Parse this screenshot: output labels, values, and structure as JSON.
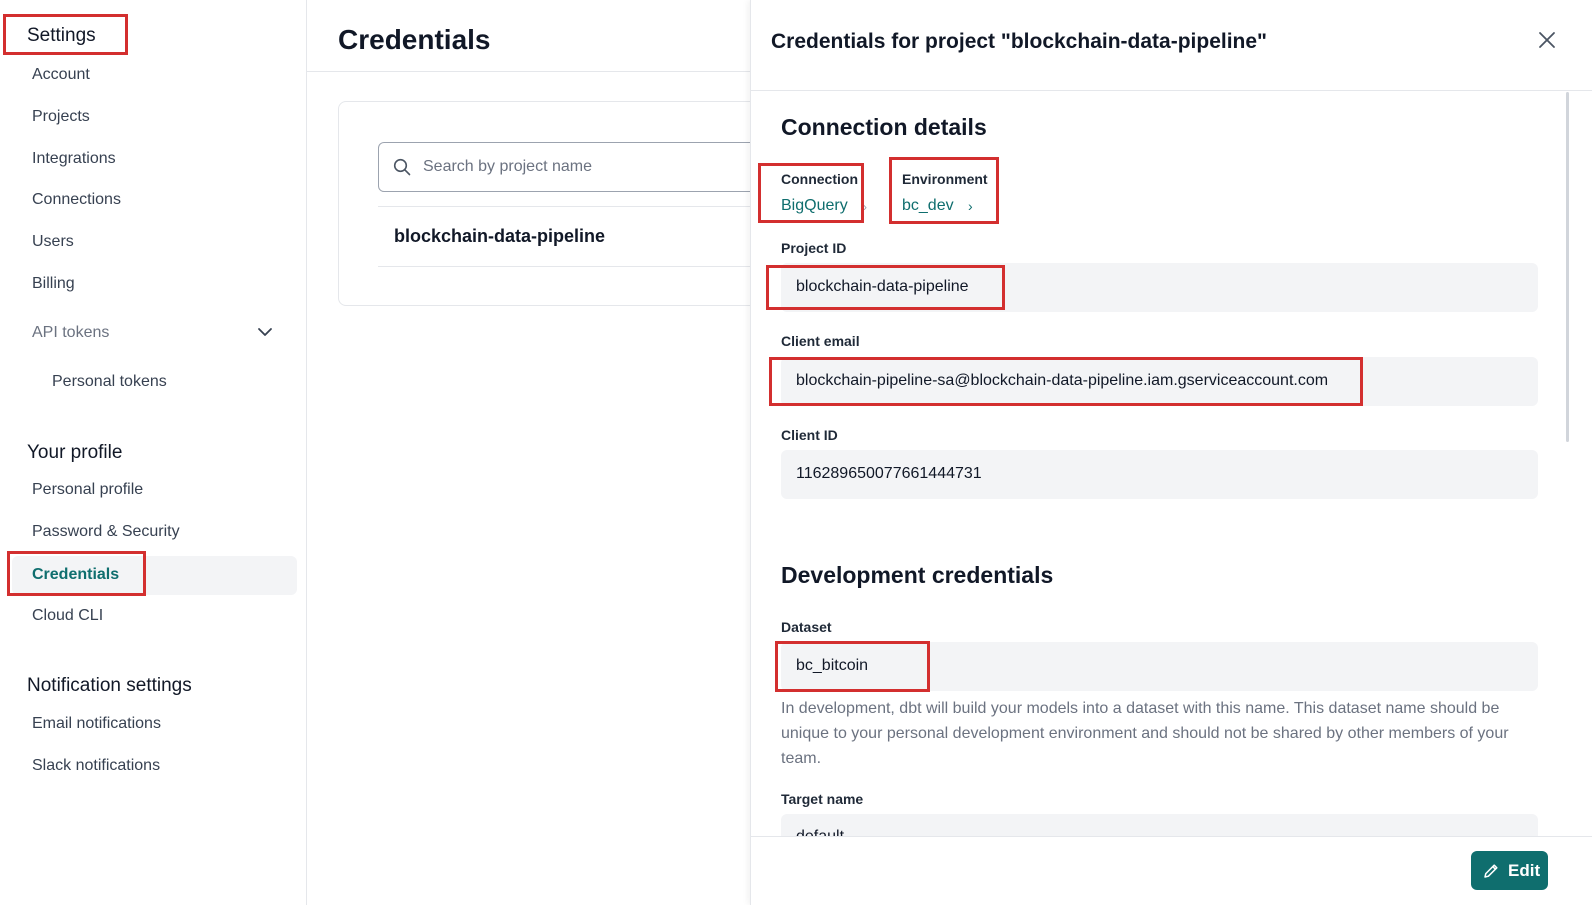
{
  "sidebar": {
    "settings_heading": "Settings",
    "settings_items": [
      "Account",
      "Projects",
      "Integrations",
      "Connections",
      "Users",
      "Billing"
    ],
    "api_tokens_label": "API tokens",
    "personal_tokens_label": "Personal tokens",
    "profile_heading": "Your profile",
    "profile_items": [
      "Personal profile",
      "Password & Security",
      "Credentials",
      "Cloud CLI"
    ],
    "notification_heading": "Notification settings",
    "notification_items": [
      "Email notifications",
      "Slack notifications"
    ]
  },
  "main": {
    "title": "Credentials",
    "search_placeholder": "Search by project name",
    "project_row": "blockchain-data-pipeline"
  },
  "drawer": {
    "title": "Credentials for project \"blockchain-data-pipeline\"",
    "connection_details_title": "Connection details",
    "connection_label": "Connection",
    "connection_value": "BigQuery",
    "environment_label": "Environment",
    "environment_value": "bc_dev",
    "project_id_label": "Project ID",
    "project_id_value": "blockchain-data-pipeline",
    "client_email_label": "Client email",
    "client_email_value": "blockchain-pipeline-sa@blockchain-data-pipeline.iam.gserviceaccount.com",
    "client_id_label": "Client ID",
    "client_id_value": "116289650077661444731",
    "dev_credentials_title": "Development credentials",
    "dataset_label": "Dataset",
    "dataset_value": "bc_bitcoin",
    "dataset_help": "In development, dbt will build your models into a dataset with this name. This dataset name should be unique to your personal development environment and should not be shared by other members of your team.",
    "target_name_label": "Target name",
    "target_name_value": "default",
    "edit_label": "Edit"
  },
  "colors": {
    "accent": "#0f6e6e",
    "annotation": "#d32f2f"
  }
}
